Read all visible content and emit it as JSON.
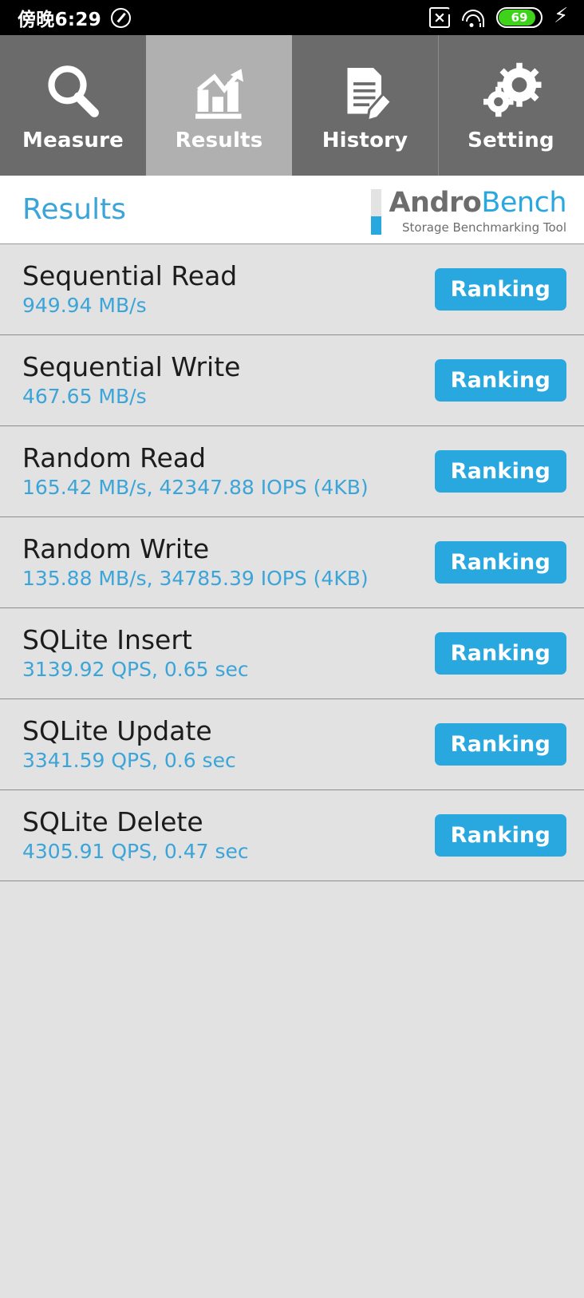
{
  "status_bar": {
    "time": "傍晚6:29",
    "dnd_icon": "do-not-disturb-icon",
    "sim_icon": "sim-card-disabled-icon",
    "wifi_icon": "wifi-icon",
    "battery_level": "69",
    "battery_color": "#3fd21a",
    "charging_icon": "lightning-bolt-icon"
  },
  "tabs": [
    {
      "label": "Measure",
      "icon": "magnifier-icon",
      "selected": false
    },
    {
      "label": "Results",
      "icon": "bar-chart-icon",
      "selected": true
    },
    {
      "label": "History",
      "icon": "document-pen-icon",
      "selected": false
    },
    {
      "label": "Setting",
      "icon": "gears-icon",
      "selected": false
    }
  ],
  "header": {
    "title": "Results",
    "logo_primary": "Andro",
    "logo_secondary": "Bench",
    "logo_tagline": "Storage Benchmarking Tool"
  },
  "colors": {
    "accent_blue": "#29a8e0",
    "title_blue": "#3ba4d8",
    "tab_bg": "#6b6b6b",
    "tab_selected_bg": "#b0b0b0",
    "list_bg": "#e2e2e2"
  },
  "results": [
    {
      "title": "Sequential Read",
      "value": "949.94 MB/s",
      "button": "Ranking"
    },
    {
      "title": "Sequential Write",
      "value": "467.65 MB/s",
      "button": "Ranking"
    },
    {
      "title": "Random Read",
      "value": "165.42 MB/s, 42347.88 IOPS (4KB)",
      "button": "Ranking"
    },
    {
      "title": "Random Write",
      "value": "135.88 MB/s, 34785.39 IOPS (4KB)",
      "button": "Ranking"
    },
    {
      "title": "SQLite Insert",
      "value": "3139.92 QPS, 0.65 sec",
      "button": "Ranking"
    },
    {
      "title": "SQLite Update",
      "value": "3341.59 QPS, 0.6 sec",
      "button": "Ranking"
    },
    {
      "title": "SQLite Delete",
      "value": "4305.91 QPS, 0.47 sec",
      "button": "Ranking"
    }
  ]
}
